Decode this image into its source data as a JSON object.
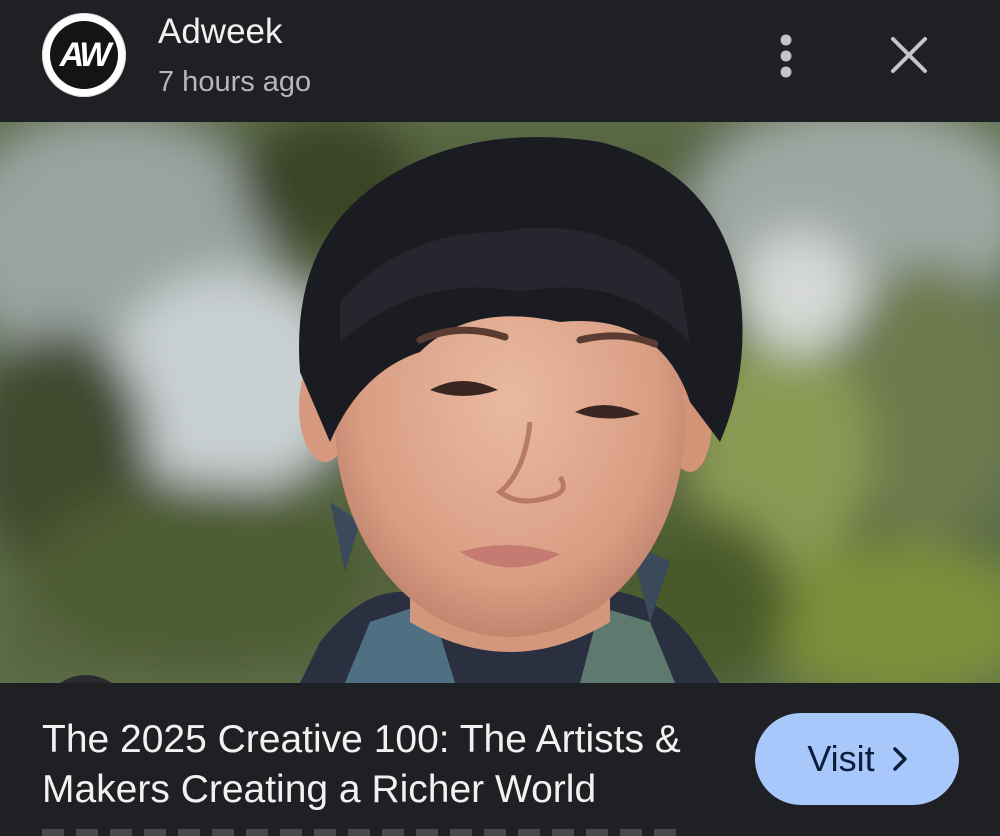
{
  "header": {
    "logo_text": "AW",
    "source_name": "Adweek",
    "time_ago": "7 hours ago",
    "more_icon": "more-vert-icon",
    "close_icon": "close-icon"
  },
  "image": {
    "lens_icon": "lens-camera-icon"
  },
  "footer": {
    "headline": "The 2025 Creative 100: The Artists & Makers Creating a Richer World",
    "visit_label": "Visit",
    "visit_icon": "chevron-right-icon"
  },
  "colors": {
    "background": "#1f2023",
    "visit_button": "#a8c7fa",
    "text_primary": "#f1f1f1",
    "text_secondary": "#b6b7bb"
  }
}
